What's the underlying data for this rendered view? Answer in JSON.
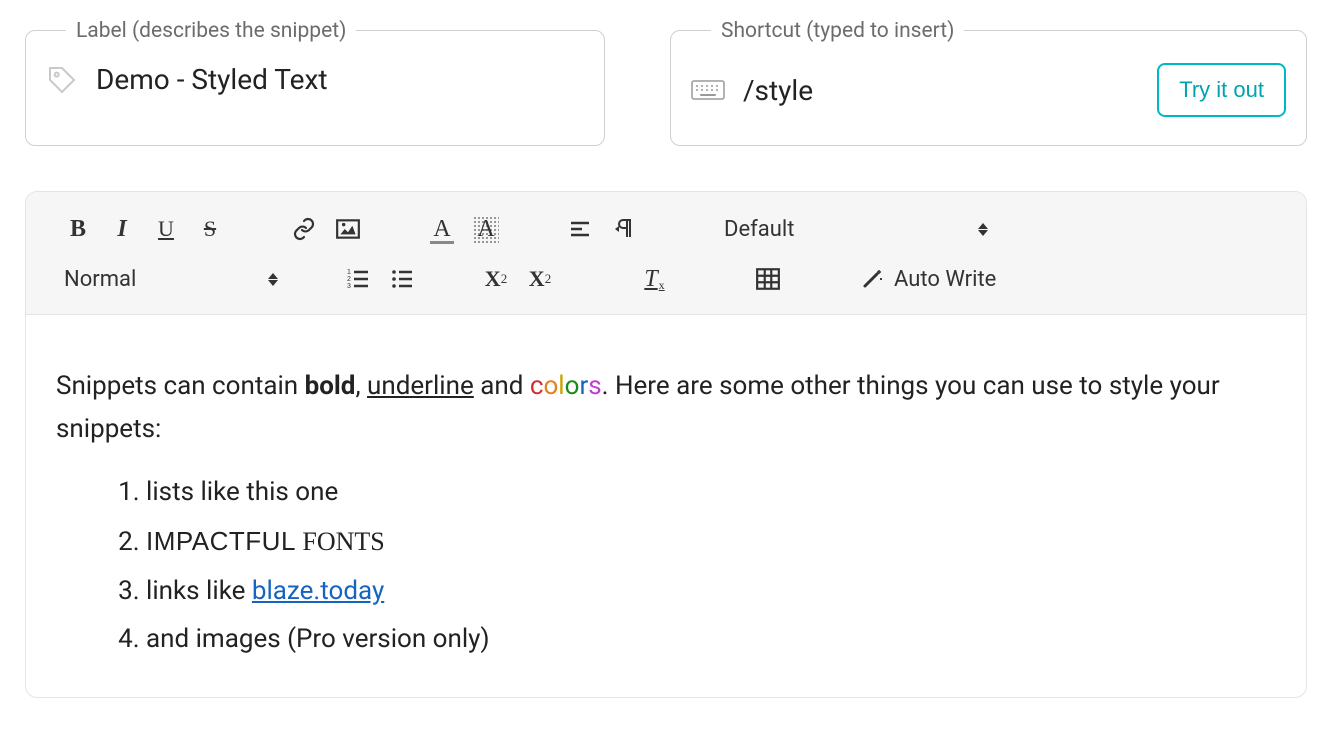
{
  "label_field": {
    "legend": "Label (describes the snippet)",
    "value": "Demo - Styled Text"
  },
  "shortcut_field": {
    "legend": "Shortcut (typed to insert)",
    "value": "/style",
    "try_button": "Try it out"
  },
  "toolbar": {
    "bold_glyph": "B",
    "italic_glyph": "I",
    "underline_glyph": "U",
    "strike_glyph": "S",
    "textcolor_glyph": "A",
    "highlight_glyph": "A",
    "sub_main": "X",
    "sub_sub": "2",
    "sup_main": "X",
    "sup_sup": "2",
    "clear_main": "T",
    "clear_x": "x",
    "font_select": "Default",
    "block_select": "Normal",
    "autowrite_label": "Auto Write"
  },
  "content": {
    "p1_part1": "Snippets can contain ",
    "p1_bold": "bold",
    "p1_part2": ", ",
    "p1_underline": "underline",
    "p1_part3": " and ",
    "colors": {
      "c": "c",
      "o": "o",
      "l": "l",
      "o2": "o",
      "r": "r",
      "s": "s"
    },
    "p1_part4": ". Here are some other things you can use to style your snippets:",
    "list": {
      "item1": "lists like this one",
      "item2_a": "IMPACTFUL",
      "item2_space": " ",
      "item2_b": "FONTS",
      "item3_a": "links like ",
      "item3_link": "blaze.today",
      "item4": "and images (Pro version only)"
    }
  }
}
